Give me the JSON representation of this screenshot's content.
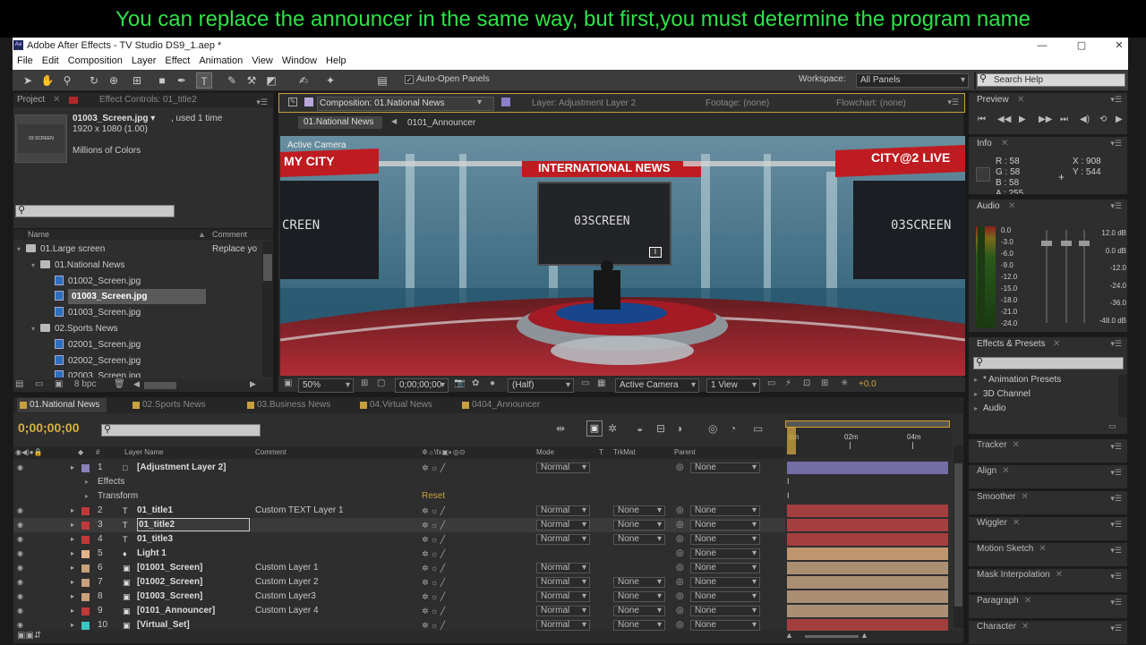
{
  "caption": "You can replace the announcer in the same way, but first,you must determine the program name",
  "window": {
    "title": "Adobe After Effects - TV Studio DS9_1.aep *",
    "icon": "Ae",
    "min": "—",
    "max": "▢",
    "close": "✕"
  },
  "menu": [
    "File",
    "Edit",
    "Composition",
    "Layer",
    "Effect",
    "Animation",
    "View",
    "Window",
    "Help"
  ],
  "toolbar": {
    "auto_open": "Auto-Open Panels",
    "workspace_label": "Workspace:",
    "workspace_value": "All Panels",
    "search_help": "Search Help"
  },
  "project": {
    "tab_project": "Project",
    "tab_effect": "Effect Controls: 01_title2",
    "file_name": "01003_Screen.jpg ▾",
    "file_used": ", used 1 time",
    "file_dim": "1920 x 1080 (1.00)",
    "file_colors": "Millions of Colors",
    "thumb_text": "03 SCREEN",
    "col_name": "Name",
    "col_comment": "Comment",
    "items": [
      {
        "label": "01.Large screen",
        "comment": "Replace yo",
        "type": "folder",
        "indent": 0
      },
      {
        "label": "01.National News",
        "comment": "",
        "type": "folder",
        "indent": 1
      },
      {
        "label": "01002_Screen.jpg",
        "comment": "",
        "type": "file",
        "indent": 2
      },
      {
        "label": "01003_Screen.jpg",
        "comment": "",
        "type": "file",
        "indent": 2,
        "selected": true
      },
      {
        "label": "01003_Screen.jpg",
        "comment": "",
        "type": "file",
        "indent": 2
      },
      {
        "label": "02.Sports News",
        "comment": "",
        "type": "folder",
        "indent": 1
      },
      {
        "label": "02001_Screen.jpg",
        "comment": "",
        "type": "file",
        "indent": 2
      },
      {
        "label": "02002_Screen.jpg",
        "comment": "",
        "type": "file",
        "indent": 2
      },
      {
        "label": "02003_Screen.jpg",
        "comment": "",
        "type": "file",
        "indent": 2
      }
    ],
    "bpc": "8 bpc"
  },
  "comp": {
    "tab": "Composition: 01.National News",
    "tab_layer": "Layer: Adjustment Layer 2",
    "tab_footage": "Footage: (none)",
    "tab_flowchart": "Flowchart: (none)",
    "crumb1": "01.National News",
    "crumb2": "0101_Announcer",
    "active_camera": "Active Camera",
    "banner_left": "MY CITY",
    "banner_center": "INTERNATIONAL NEWS",
    "banner_right": "CITY@2 LIVE",
    "screen_left": "CREEN",
    "screen_center": "03SCREEN",
    "screen_right": "03SCREEN",
    "zoom": "50%",
    "timecode": "0;00;00;00",
    "resolution": "(Half)",
    "camera": "Active Camera",
    "views": "1 View",
    "exposure": "+0.0"
  },
  "preview": {
    "title": "Preview"
  },
  "info": {
    "title": "Info",
    "r": "R : 58",
    "g": "G : 58",
    "b": "B : 58",
    "a": "A : 255",
    "x": "X : 908",
    "y": "Y : 544"
  },
  "audio": {
    "title": "Audio",
    "left_scale": [
      "0.0",
      "-3.0",
      "-6.0",
      "-9.0",
      "-12.0",
      "-15.0",
      "-18.0",
      "-21.0",
      "-24.0"
    ],
    "right_scale": [
      "12.0 dB",
      "0.0 dB",
      "-12.0",
      "-24.0",
      "-36.0",
      "-48.0 dB"
    ]
  },
  "effects": {
    "title": "Effects & Presets",
    "items": [
      "* Animation Presets",
      "3D Channel",
      "Audio"
    ]
  },
  "side_panels": [
    "Tracker",
    "Align",
    "Smoother",
    "Wiggler",
    "Motion Sketch",
    "Mask Interpolation",
    "Paragraph",
    "Character"
  ],
  "timeline": {
    "tabs": [
      "01.National News",
      "02.Sports News",
      "03.Business News",
      "04.Virtual News",
      "0404_Announcer"
    ],
    "timecode": "0;00;00;00",
    "col_layer": "Layer Name",
    "col_comment": "Comment",
    "col_mode": "Mode",
    "col_t": "T",
    "col_trkmat": "TrkMat",
    "col_parent": "Parent",
    "ruler": [
      "0m",
      "02m",
      "04m"
    ],
    "sub_effects": "Effects",
    "sub_transform": "Transform",
    "reset": "Reset",
    "layers": [
      {
        "num": "1",
        "name": "[Adjustment Layer 2]",
        "comment": "",
        "mode": "Normal",
        "trk": "",
        "parent": "None",
        "color": "#8a7fb8",
        "bar": "#7e78b8",
        "icon": "□"
      },
      {
        "num": "2",
        "name": "01_title1",
        "comment": "Custom TEXT Layer 1",
        "mode": "Normal",
        "trk": "None",
        "parent": "None",
        "color": "#c03838",
        "bar": "#b84242",
        "icon": "T"
      },
      {
        "num": "3",
        "name": "01_title2",
        "comment": "",
        "mode": "Normal",
        "trk": "None",
        "parent": "None",
        "color": "#c03838",
        "bar": "#b84242",
        "icon": "T",
        "selected": true
      },
      {
        "num": "4",
        "name": "01_title3",
        "comment": "",
        "mode": "Normal",
        "trk": "None",
        "parent": "None",
        "color": "#c03838",
        "bar": "#b84242",
        "icon": "T"
      },
      {
        "num": "5",
        "name": "Light 1",
        "comment": "",
        "mode": "",
        "trk": "",
        "parent": "None",
        "color": "#e0b48a",
        "bar": "#d8a878",
        "icon": "♦"
      },
      {
        "num": "6",
        "name": "[01001_Screen]",
        "comment": "Custom Layer 1",
        "mode": "Normal",
        "trk": "",
        "parent": "None",
        "color": "#c8a07a",
        "bar": "#c0a080",
        "icon": "▣"
      },
      {
        "num": "7",
        "name": "[01002_Screen]",
        "comment": "Custom Layer 2",
        "mode": "Normal",
        "trk": "None",
        "parent": "None",
        "color": "#c8a07a",
        "bar": "#c0a080",
        "icon": "▣"
      },
      {
        "num": "8",
        "name": "[01003_Screen]",
        "comment": "Custom Layer3",
        "mode": "Normal",
        "trk": "None",
        "parent": "None",
        "color": "#c8a07a",
        "bar": "#c0a080",
        "icon": "▣"
      },
      {
        "num": "9",
        "name": "[0101_Announcer]",
        "comment": "Custom Layer 4",
        "mode": "Normal",
        "trk": "None",
        "parent": "None",
        "color": "#c03838",
        "bar": "#c0a080",
        "icon": "▣"
      },
      {
        "num": "10",
        "name": "[Virtual_Set]",
        "comment": "",
        "mode": "Normal",
        "trk": "None",
        "parent": "None",
        "color": "#3cc4c4",
        "bar": "#b84242",
        "icon": "▣"
      }
    ]
  }
}
